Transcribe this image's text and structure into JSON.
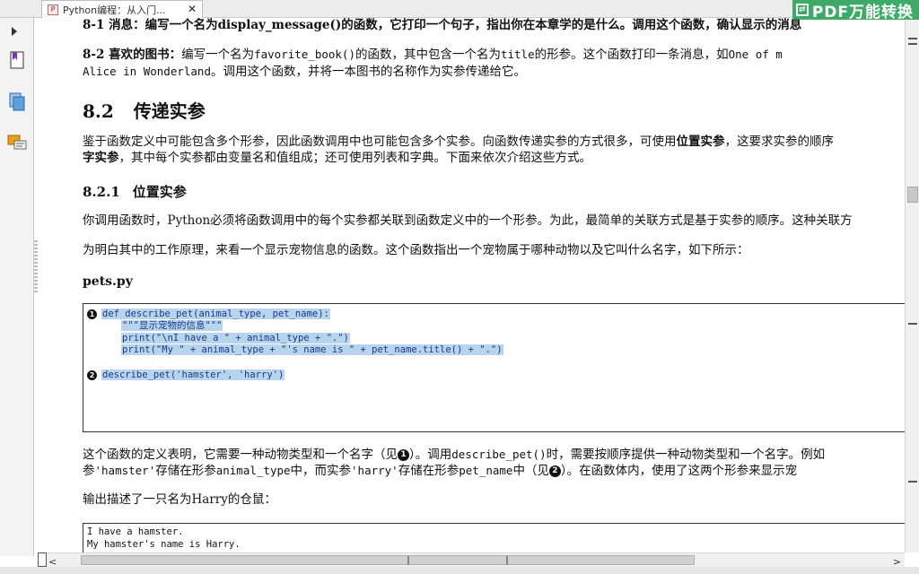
{
  "tab": {
    "title": "Python编程：从入门...",
    "close": "✕"
  },
  "watermark": {
    "text": "PDF万能转换"
  },
  "lines": {
    "ex81": "8-1 消息：编写一个名为display_message()的函数，它打印一个句子，指出你在本章学的是什么。调用这个函数，确认显示的消息",
    "ex82_a_label": "8-2 喜欢的图书：",
    "ex82_a_text": "编写一个名为",
    "ex82_a_code1": "favorite_book()",
    "ex82_a_text2": "的函数，其中包含一个名为",
    "ex82_a_code2": "title",
    "ex82_a_text3": "的形参。这个函数打印一条消息，如",
    "ex82_a_code3": "One of m",
    "ex82_b_code": "Alice in Wonderland",
    "ex82_b_text": "。调用这个函数，并将一本图书的名称作为实参传递给它。"
  },
  "section": {
    "number": "8.2",
    "title": "传递实参"
  },
  "para1": {
    "a": "鉴于函数定义中可能包含多个形参，因此函数调用中也可能包含多个实参。向函数传递实参的方式很多，可使用",
    "a_bold": "位置实参",
    "a_end": "，这要求实参的顺序",
    "b_bold": "字实参",
    "b": "，其中每个实参都由变量名和值组成；还可使用列表和字典。下面来依次介绍这些方式。"
  },
  "subsection": {
    "number": "8.2.1",
    "title": "位置实参"
  },
  "para2": "你调用函数时，Python必须将函数调用中的每个实参都关联到函数定义中的一个形参。为此，最简单的关联方式是基于实参的顺序。这种关联方",
  "para3": "为明白其中的工作原理，来看一个显示宠物信息的函数。这个函数指出一个宠物属于哪种动物以及它叫什么名字，如下所示：",
  "filename": "pets.py",
  "code": {
    "marker1": "1",
    "line1": "def describe_pet(animal_type, pet_name):",
    "line2": "\"\"\"显示宠物的信息\"\"\"",
    "line3": "print(\"\\nI have a \" + animal_type + \".\")",
    "line4": "print(\"My \" + animal_type + \"'s name is \" + pet_name.title() + \".\")",
    "marker2": "2",
    "line5": "describe_pet('hamster', 'harry')"
  },
  "para4": {
    "a": "这个函数的定义表明，它需要一种动物类型和一个名字（见",
    "m1": "1",
    "b": "）。调用",
    "code1": "describe_pet()",
    "c": "时，需要按顺序提供一种动物类型和一个名字。例如",
    "d": "参",
    "code2": "'hamster'",
    "e": "存储在形参",
    "code3": "animal_type",
    "f": "中，而实参",
    "code4": "'harry'",
    "g": "存储在形参",
    "code5": "pet_name",
    "h": "中（见",
    "m2": "2",
    "i": "）。在函数体内，使用了这两个形参来显示宠"
  },
  "para5": "输出描述了一只名为Harry的仓鼠：",
  "output": {
    "line1": "I have a hamster.",
    "line2": "My hamster's name is Harry."
  },
  "colors": {
    "highlight": "#b8d3ec",
    "watermark": "#1ea050"
  },
  "icons": [
    "expand-arrow-icon",
    "bookmark-icon",
    "pages-icon",
    "comments-icon"
  ]
}
